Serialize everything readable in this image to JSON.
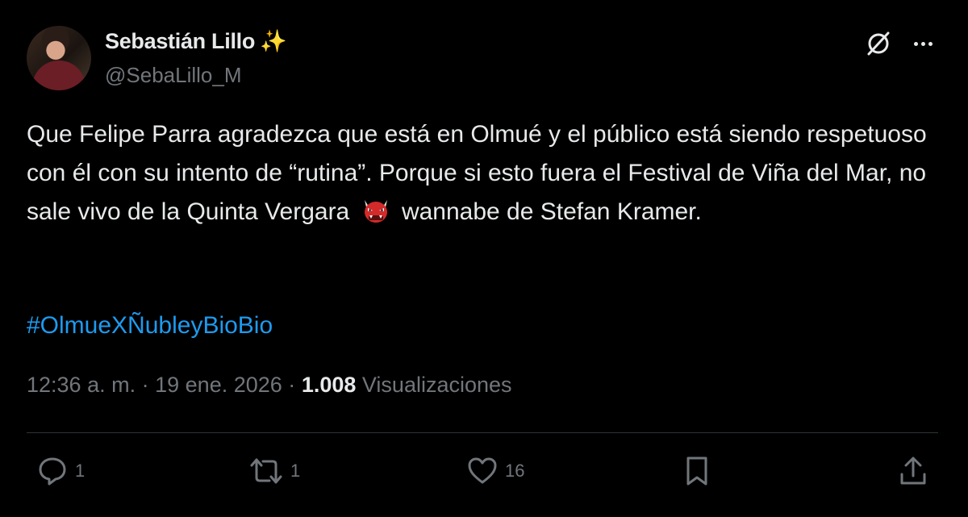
{
  "user": {
    "display_name": "Sebastián Lillo",
    "badge_emoji": "✨",
    "handle": "@SebaLillo_M"
  },
  "tweet": {
    "text_before_emoji": "Que Felipe Parra agradezca que está en Olmué y el público está siendo respetuoso con él con su intento de “rutina”. Porque si esto fuera el Festival de Viña del Mar, no sale vivo de la Quinta Vergara",
    "emoji": "👹",
    "text_after_emoji": "wannabe de Stefan Kramer.",
    "hashtag": "#OlmueXÑubleyBioBio"
  },
  "meta": {
    "time": "12:36 a. m.",
    "separator": "·",
    "date": "19 ene. 2026",
    "views_count": "1.008",
    "views_label": "Visualizaciones"
  },
  "actions": {
    "replies": "1",
    "reposts": "1",
    "likes": "16"
  },
  "icons": {
    "grok": "grok-icon",
    "more": "more-icon",
    "reply": "reply-icon",
    "repost": "repost-icon",
    "like": "heart-icon",
    "bookmark": "bookmark-icon",
    "share": "share-icon"
  },
  "colors": {
    "background": "#000000",
    "text": "#e7e9ea",
    "muted": "#71767b",
    "link": "#1d9bf0",
    "divider": "#2f3336"
  }
}
